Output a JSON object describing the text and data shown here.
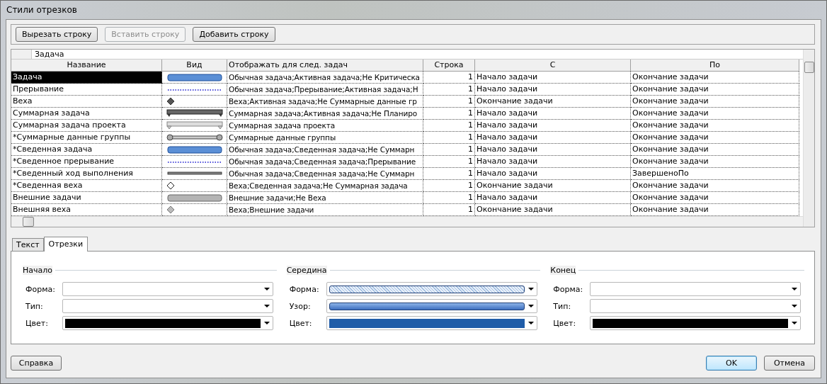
{
  "window": {
    "title": "Стили отрезков"
  },
  "toolbar": [
    {
      "label": "Вырезать строку",
      "disabled": false
    },
    {
      "label": "Вставить строку",
      "disabled": true
    },
    {
      "label": "Добавить строку",
      "disabled": false
    }
  ],
  "entry": {
    "value": "Задача"
  },
  "table": {
    "columns": [
      "Название",
      "Вид",
      "Отображать для след. задач",
      "Строка",
      "С",
      "По"
    ],
    "rows": [
      {
        "name": "Задача",
        "kind": "bar-blue",
        "show_for": "Обычная задача;Активная задача;Не Критическа",
        "row": "1",
        "from": "Начало задачи",
        "to": "Окончание задачи",
        "selected": true
      },
      {
        "name": "Прерывание",
        "kind": "dotted",
        "show_for": "Обычная задача;Прерывание;Активная задача;Н",
        "row": "1",
        "from": "Начало задачи",
        "to": "Окончание задачи",
        "selected": false
      },
      {
        "name": "Веха",
        "kind": "diamond-dark",
        "show_for": "Веха;Активная задача;Не Суммарные данные гр",
        "row": "1",
        "from": "Окончание задачи",
        "to": "Окончание задачи",
        "selected": false
      },
      {
        "name": "Суммарная задача",
        "kind": "summary-dark",
        "show_for": "Суммарная задача;Активная задача;Не Планиро",
        "row": "1",
        "from": "Начало задачи",
        "to": "Окончание задачи",
        "selected": false
      },
      {
        "name": "Суммарная задача проекта",
        "kind": "summary-light",
        "show_for": "Суммарная задача проекта",
        "row": "1",
        "from": "Начало задачи",
        "to": "Окончание задачи",
        "selected": false
      },
      {
        "name": "*Суммарные данные группы",
        "kind": "group",
        "show_for": "Суммарные данные группы",
        "row": "1",
        "from": "Начало задачи",
        "to": "Окончание задачи",
        "selected": false
      },
      {
        "name": "*Сведенная задача",
        "kind": "bar-blue",
        "show_for": "Обычная задача;Сведенная задача;Не Суммарн",
        "row": "1",
        "from": "Начало задачи",
        "to": "Окончание задачи",
        "selected": false
      },
      {
        "name": "*Сведенное прерывание",
        "kind": "dotted",
        "show_for": "Обычная задача;Сведенная задача;Прерывание",
        "row": "1",
        "from": "Начало задачи",
        "to": "Окончание задачи",
        "selected": false
      },
      {
        "name": "*Сведенный ход выполнения",
        "kind": "thin-line",
        "show_for": "Обычная задача;Сведенная задача;Не Суммарн",
        "row": "1",
        "from": "Начало задачи",
        "to": "ЗавершеноПо",
        "selected": false
      },
      {
        "name": "*Сведенная веха",
        "kind": "diamond-white",
        "show_for": "Веха;Сведенная задача;Не Суммарная задача",
        "row": "1",
        "from": "Окончание задачи",
        "to": "Окончание задачи",
        "selected": false
      },
      {
        "name": "Внешние задачи",
        "kind": "bar-gray",
        "show_for": "Внешние задачи;Не Веха",
        "row": "1",
        "from": "Начало задачи",
        "to": "Окончание задачи",
        "selected": false
      },
      {
        "name": "Внешняя веха",
        "kind": "diamond-gray",
        "show_for": "Веха;Внешние задачи",
        "row": "1",
        "from": "Окончание задачи",
        "to": "Окончание задачи",
        "selected": false
      }
    ]
  },
  "tabs": [
    {
      "label": "Текст",
      "selected": false
    },
    {
      "label": "Отрезки",
      "selected": true
    }
  ],
  "groups": [
    {
      "title": "Начало",
      "fields": [
        {
          "label": "Форма:",
          "kind": "empty"
        },
        {
          "label": "Тип:",
          "kind": "empty"
        },
        {
          "label": "Цвет:",
          "kind": "swatch",
          "color": "#000000"
        }
      ]
    },
    {
      "title": "Середина",
      "fields": [
        {
          "label": "Форма:",
          "kind": "hatched"
        },
        {
          "label": "Узор:",
          "kind": "bar"
        },
        {
          "label": "Цвет:",
          "kind": "swatch",
          "color": "#1f5ca8"
        }
      ]
    },
    {
      "title": "Конец",
      "fields": [
        {
          "label": "Форма:",
          "kind": "empty"
        },
        {
          "label": "Тип:",
          "kind": "empty"
        },
        {
          "label": "Цвет:",
          "kind": "swatch",
          "color": "#000000"
        }
      ]
    }
  ],
  "buttons": [
    {
      "label": "Справка",
      "kind": "left"
    },
    {
      "label": "OK",
      "kind": "default"
    },
    {
      "label": "Отмена",
      "kind": "normal"
    }
  ]
}
